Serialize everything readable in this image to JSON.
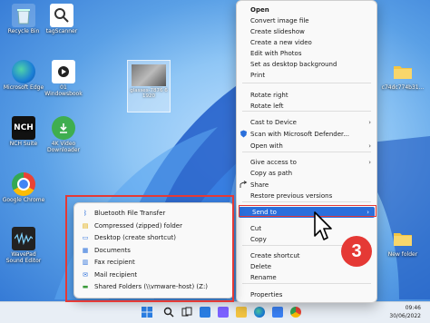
{
  "desktop": {
    "icons": [
      {
        "label": "Recycle Bin",
        "icon": "recycle-bin-icon"
      },
      {
        "label": "tagScanner",
        "icon": "tagscanner-icon"
      },
      {
        "label": "Microsoft Edge",
        "icon": "edge-icon"
      },
      {
        "label": "01 Windowsbook",
        "icon": "video-file-icon"
      },
      {
        "label": "NCH Suite",
        "icon": "nch-icon"
      },
      {
        "label": "4K Video Downloader",
        "icon": "downloader-icon"
      },
      {
        "label": "Google Chrome",
        "icon": "chrome-icon"
      },
      {
        "label": "WavePad Sound Editor",
        "icon": "wavepad-icon"
      },
      {
        "label": "c74dc774b31...",
        "icon": "folder-icon"
      },
      {
        "label": "New folder",
        "icon": "folder-icon"
      }
    ],
    "selected_file": {
      "label": "glasses-7876 6 1920"
    }
  },
  "context_menu": {
    "items": [
      {
        "label": "Open",
        "icon": "",
        "bold": true,
        "submenu": false
      },
      {
        "label": "Convert image file",
        "icon": "",
        "submenu": false
      },
      {
        "label": "Create slideshow",
        "icon": "",
        "submenu": false
      },
      {
        "label": "Create a new video",
        "icon": "",
        "submenu": false
      },
      {
        "label": "Edit with Photos",
        "icon": "",
        "submenu": false
      },
      {
        "label": "Set as desktop background",
        "icon": "",
        "submenu": false
      },
      {
        "label": "Print",
        "icon": "",
        "submenu": false
      },
      {
        "label": "Rotate right",
        "icon": "",
        "submenu": false
      },
      {
        "label": "Rotate left",
        "icon": "",
        "submenu": false
      },
      {
        "label": "Cast to Device",
        "icon": "",
        "submenu": true
      },
      {
        "label": "Scan with Microsoft Defender...",
        "icon": "defender-shield-icon",
        "submenu": false
      },
      {
        "label": "Open with",
        "icon": "",
        "submenu": true
      },
      {
        "label": "Give access to",
        "icon": "",
        "submenu": true
      },
      {
        "label": "Copy as path",
        "icon": "",
        "submenu": false
      },
      {
        "label": "Share",
        "icon": "share-icon",
        "submenu": false
      },
      {
        "label": "Restore previous versions",
        "icon": "",
        "submenu": false
      },
      {
        "label": "Send to",
        "icon": "",
        "submenu": true,
        "highlighted": true
      },
      {
        "label": "Cut",
        "icon": "",
        "submenu": false
      },
      {
        "label": "Copy",
        "icon": "",
        "submenu": false
      },
      {
        "label": "Create shortcut",
        "icon": "",
        "submenu": false
      },
      {
        "label": "Delete",
        "icon": "",
        "submenu": false
      },
      {
        "label": "Rename",
        "icon": "",
        "submenu": false
      },
      {
        "label": "Properties",
        "icon": "",
        "submenu": false
      }
    ]
  },
  "send_to_menu": {
    "items": [
      {
        "label": "Bluetooth File Transfer",
        "icon": "bluetooth-icon"
      },
      {
        "label": "Compressed (zipped) folder",
        "icon": "zip-folder-icon"
      },
      {
        "label": "Desktop (create shortcut)",
        "icon": "desktop-icon"
      },
      {
        "label": "Documents",
        "icon": "documents-icon"
      },
      {
        "label": "Fax recipient",
        "icon": "fax-icon"
      },
      {
        "label": "Mail recipient",
        "icon": "mail-icon"
      },
      {
        "label": "Shared Folders (\\\\vmware-host) (Z:)",
        "icon": "network-drive-icon"
      }
    ]
  },
  "step_badge": "3",
  "taskbar": {
    "time": "09:46",
    "date": "30/06/2022"
  },
  "colors": {
    "accent": "#2a6fdb",
    "highlight_box": "#e53935"
  }
}
